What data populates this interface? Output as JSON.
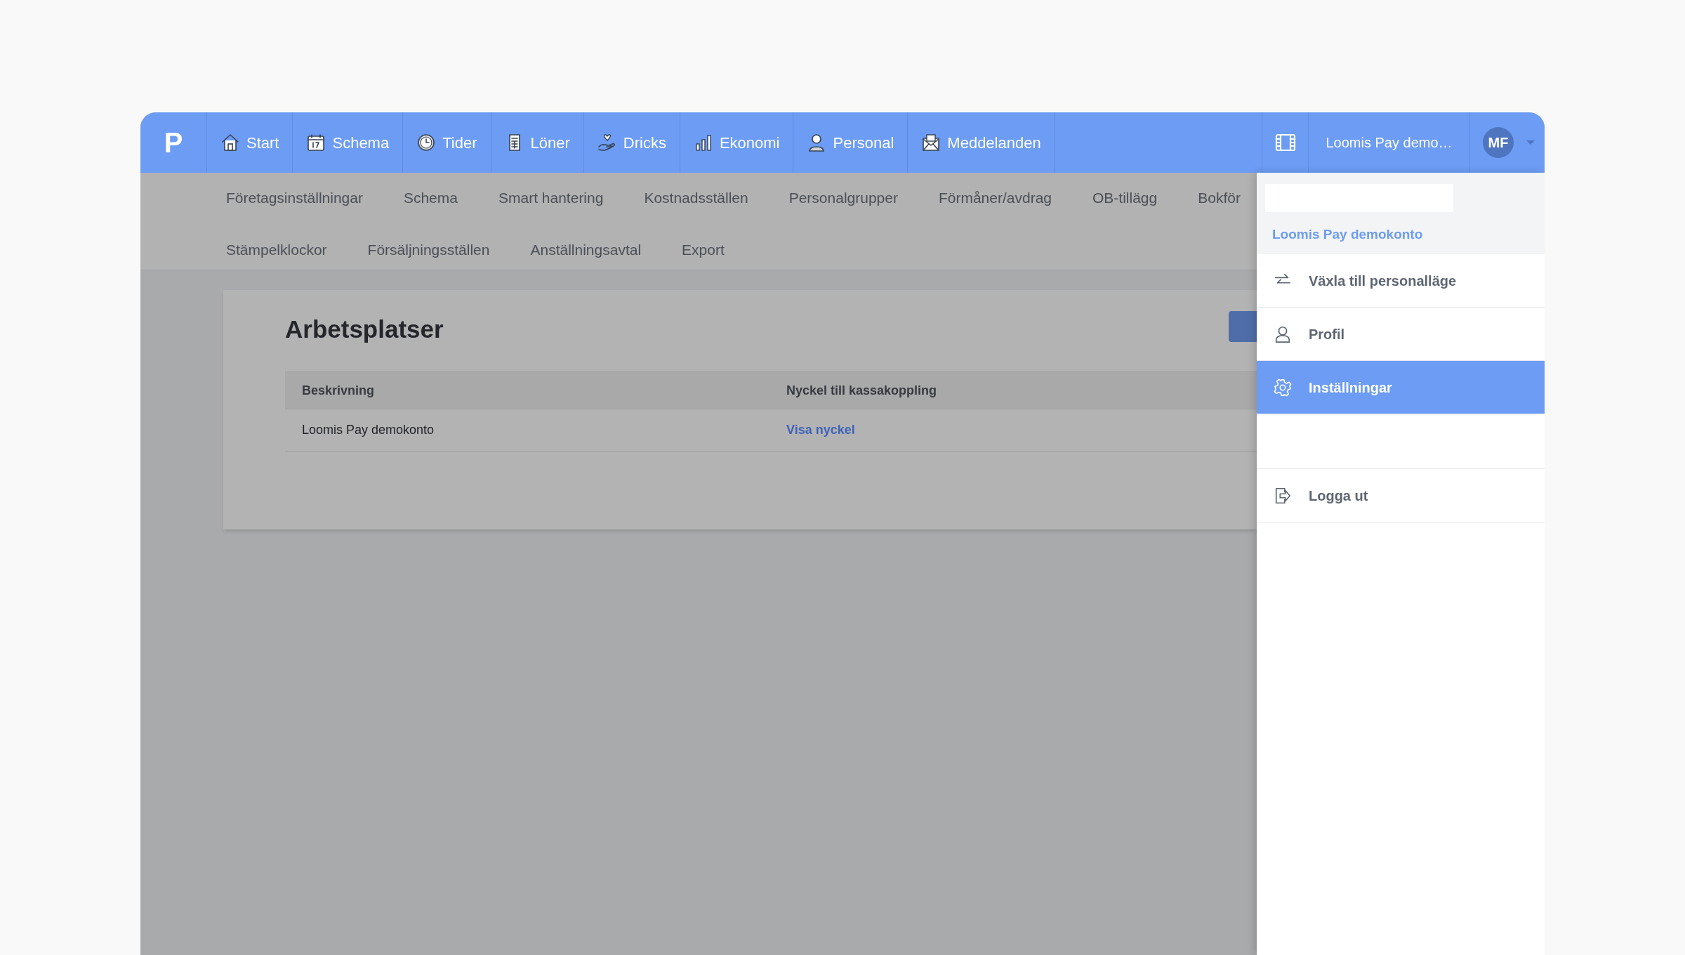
{
  "navbar": {
    "logo": "P",
    "items": [
      {
        "label": "Start"
      },
      {
        "label": "Schema"
      },
      {
        "label": "Tider"
      },
      {
        "label": "Löner"
      },
      {
        "label": "Dricks"
      },
      {
        "label": "Ekonomi"
      },
      {
        "label": "Personal"
      },
      {
        "label": "Meddelanden"
      }
    ],
    "account": "Loomis Pay demo…",
    "initials": "MF"
  },
  "subnav": [
    [
      "Företagsinställningar",
      "Schema",
      "Smart hantering",
      "Kostnadsställen",
      "Personalgrupper",
      "Förmåner/avdrag",
      "OB-tillägg",
      "Bokför"
    ],
    [
      "Stämpelklockor",
      "Försäljningsställen",
      "Anställningsavtal",
      "Export"
    ]
  ],
  "page": {
    "title": "Arbetsplatser",
    "table": {
      "columns": [
        "Beskrivning",
        "Nyckel till kassakoppling"
      ],
      "rows": [
        {
          "cells": [
            "Loomis Pay demokonto",
            "Visa nyckel"
          ]
        }
      ]
    }
  },
  "menu": {
    "account_label": "Loomis Pay demokonto",
    "items": [
      {
        "kind": "item",
        "label": "Växla till personalläge",
        "selected": false
      },
      {
        "kind": "item",
        "label": "Profil",
        "selected": false
      },
      {
        "kind": "item",
        "label": "Inställningar",
        "selected": true
      },
      {
        "kind": "spacer"
      },
      {
        "kind": "item",
        "label": "Logga ut",
        "selected": false
      }
    ]
  }
}
